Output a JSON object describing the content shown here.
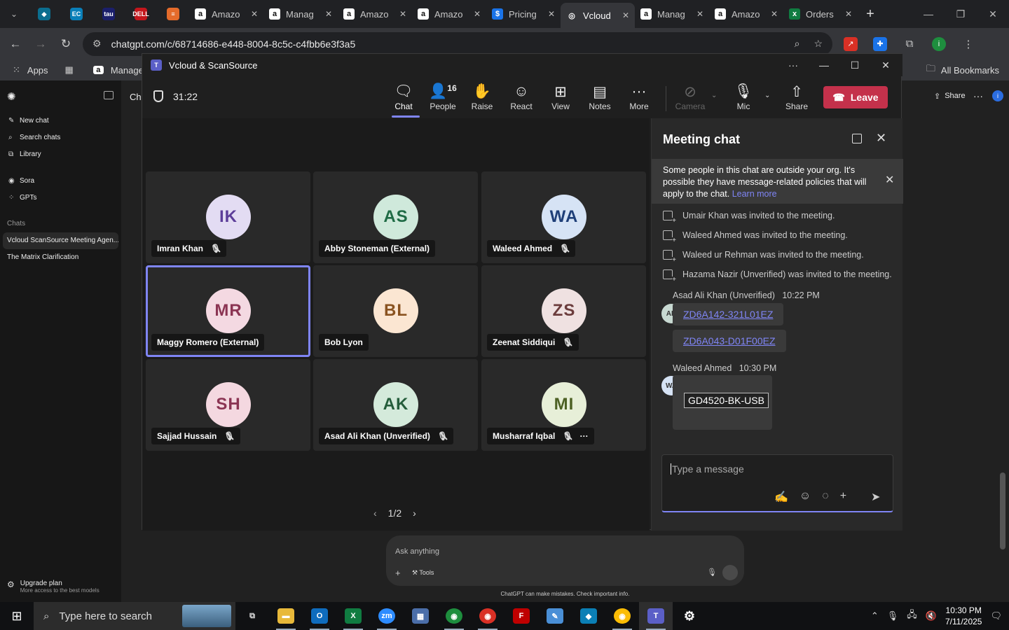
{
  "browser": {
    "tabs": [
      {
        "label": "Amazo",
        "fav": "a",
        "fav_color": "#ffffff",
        "fav_fg": "#111111"
      },
      {
        "label": "Manag",
        "fav": "a",
        "fav_color": "#ffffff",
        "fav_fg": "#111111"
      },
      {
        "label": "Amazo",
        "fav": "a",
        "fav_color": "#ffffff",
        "fav_fg": "#111111"
      },
      {
        "label": "Amazo",
        "fav": "a",
        "fav_color": "#ffffff",
        "fav_fg": "#111111"
      },
      {
        "label": "Pricing",
        "fav": "$",
        "fav_color": "#1a73e8",
        "fav_fg": "#ffffff"
      },
      {
        "label": "Vcloud",
        "fav": "◎",
        "fav_color": "#35363a",
        "fav_fg": "#ffffff",
        "active": true
      },
      {
        "label": "Manag",
        "fav": "a",
        "fav_color": "#ffffff",
        "fav_fg": "#111111"
      },
      {
        "label": "Amazo",
        "fav": "a",
        "fav_color": "#ffffff",
        "fav_fg": "#111111"
      },
      {
        "label": "Orders",
        "fav": "x",
        "fav_color": "#107c41",
        "fav_fg": "#ffffff"
      }
    ],
    "pinned_tab_icons": [
      "chevron-down-icon",
      "diamond-icon",
      "ec-icon",
      "tau-icon",
      "dell-icon",
      "stack-icon"
    ],
    "pinned": [
      {
        "name": "blue-diamond-favicon",
        "glyph": "◆",
        "bg": "#0b6e8f"
      },
      {
        "name": "ec-favicon",
        "glyph": "EC",
        "bg": "#0a7fb8"
      },
      {
        "name": "tau-favicon",
        "glyph": "tau",
        "bg": "#1b1f6b"
      },
      {
        "name": "dell-favicon",
        "glyph": "DELL",
        "bg": "#c4161c"
      },
      {
        "name": "stack-favicon",
        "glyph": "≡",
        "bg": "#e46b2b"
      }
    ],
    "url": "chatgpt.com/c/68714686-e448-8004-8c5c-c4fbb6e3f3a5",
    "bookmarks": {
      "apps_label": "Apps",
      "manage_label": "Manage Y",
      "all_bookmarks_label": "All Bookmarks"
    },
    "accent_colors": {
      "profile": "#1e8e3e",
      "leave": "#c4314b",
      "teams_accent": "#7f85f5"
    }
  },
  "gpt": {
    "sidebar": {
      "new_chat": "New chat",
      "search_chats": "Search chats",
      "library": "Library",
      "sora": "Sora",
      "gpts": "GPTs",
      "chats_heading": "Chats",
      "chats": [
        "Vcloud ScanSource Meeting Agen...",
        "The Matrix Clarification"
      ],
      "upgrade_title": "Upgrade plan",
      "upgrade_sub": "More access to the best models"
    },
    "header_title": "Cha",
    "share": "Share",
    "ask_placeholder": "Ask anything",
    "tools_label": "Tools",
    "disclaimer": "ChatGPT can make mistakes. Check important info."
  },
  "teams": {
    "window_title": "Vcloud & ScanSource",
    "timer": "31:22",
    "toolbar": {
      "chat": "Chat",
      "people": "People",
      "people_count": "16",
      "raise": "Raise",
      "react": "React",
      "view": "View",
      "notes": "Notes",
      "more": "More",
      "camera": "Camera",
      "mic": "Mic",
      "share": "Share",
      "leave": "Leave"
    },
    "participants": [
      {
        "initials": "IK",
        "name": "Imran Khan",
        "muted": true,
        "bg": "#e3dcf3",
        "fg": "#5c3d99"
      },
      {
        "initials": "AS",
        "name": "Abby Stoneman (External)",
        "muted": false,
        "bg": "#cfe9db",
        "fg": "#1f6b45"
      },
      {
        "initials": "WA",
        "name": "Waleed Ahmed",
        "muted": true,
        "bg": "#d6e3f5",
        "fg": "#1f3f78"
      },
      {
        "initials": "MR",
        "name": "Maggy Romero (External)",
        "muted": false,
        "bg": "#f4d9e2",
        "fg": "#8b3453",
        "selected": true
      },
      {
        "initials": "BL",
        "name": "Bob Lyon",
        "muted": false,
        "bg": "#fbe6d2",
        "fg": "#8a5320"
      },
      {
        "initials": "ZS",
        "name": "Zeenat Siddiqui",
        "muted": true,
        "bg": "#efe1e1",
        "fg": "#6b3c3c"
      },
      {
        "initials": "SH",
        "name": "Sajjad Hussain",
        "muted": true,
        "bg": "#f4d8e0",
        "fg": "#8b3453"
      },
      {
        "initials": "AK",
        "name": "Asad Ali Khan (Unverified)",
        "muted": true,
        "bg": "#d4eadb",
        "fg": "#245d3b"
      },
      {
        "initials": "MI",
        "name": "Musharraf Iqbal",
        "muted": true,
        "bg": "#e7efd8",
        "fg": "#4d6124",
        "more": true
      }
    ],
    "pager": "1/2",
    "chat": {
      "heading": "Meeting chat",
      "notice": "Some people in this chat are outside your org. It's possible they have message-related policies that will apply to the chat.",
      "notice_link": "Learn more",
      "system_messages": [
        "Umair Khan was invited to the meeting.",
        "Waleed Ahmed was invited to the meeting.",
        "Waleed ur Rehman was invited to the meeting.",
        "Hazama Nazir (Unverified) was invited to the meeting."
      ],
      "msg1_sender": "Asad Ali Khan (Unverified)",
      "msg1_time": "10:22 PM",
      "msg1_avatar": "AK",
      "msg1_links": [
        "ZD6A142-321L01EZ",
        "ZD6A043-D01F00EZ"
      ],
      "msg2_sender": "Waleed Ahmed",
      "msg2_time": "10:30 PM",
      "msg2_avatar": "WA",
      "msg2_code": "GD4520-BK-USB",
      "compose_placeholder": "Type a message"
    }
  },
  "taskbar": {
    "search_placeholder": "Type here to search",
    "time": "10:30 PM",
    "date": "7/11/2025"
  }
}
